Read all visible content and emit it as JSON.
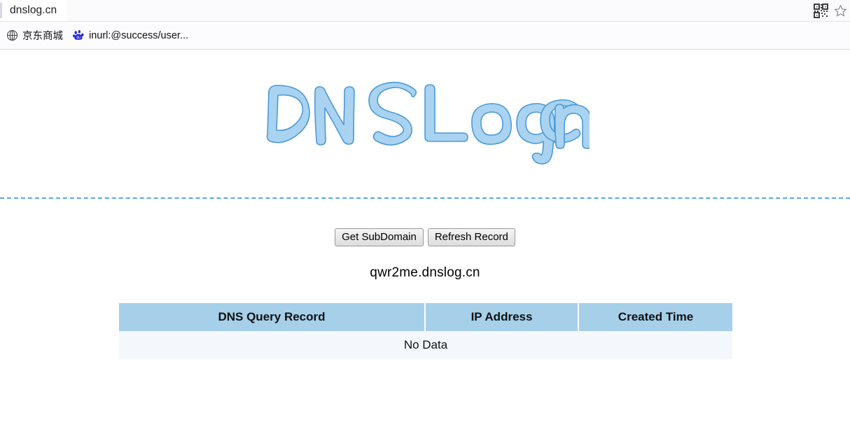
{
  "browser": {
    "tab": {
      "title": "dnslog.cn"
    },
    "right_icons": [
      {
        "name": "qr-code-icon",
        "label": "QR code"
      },
      {
        "name": "star-icon",
        "label": "Add to favorites"
      }
    ],
    "bookmarks": [
      {
        "icon": "globe-icon",
        "label": "京东商城"
      },
      {
        "icon": "baidu-paw-icon",
        "label": "inurl:@success/user..."
      }
    ]
  },
  "page": {
    "logo_text": "DNSLog.cn",
    "logo_color": "#a9d3f0",
    "logo_outline_color": "#4a9ad8",
    "divider_color": "#53a7ec",
    "buttons": {
      "get_subdomain": "Get SubDomain",
      "refresh_record": "Refresh Record"
    },
    "subdomain": "qwr2me.dnslog.cn",
    "table": {
      "header_color": "#a6cfe9",
      "row_color": "#f4f8fd",
      "columns": [
        "DNS Query Record",
        "IP Address",
        "Created Time"
      ],
      "empty_message": "No Data",
      "rows": []
    }
  }
}
